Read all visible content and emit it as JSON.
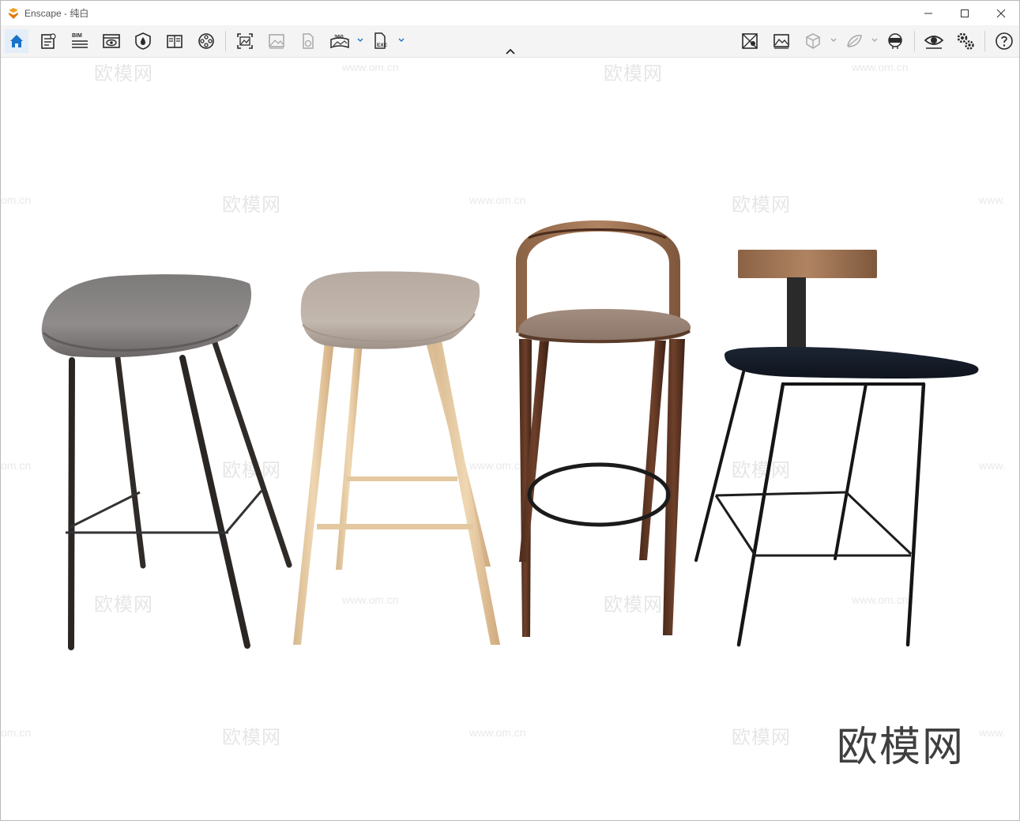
{
  "window": {
    "app_name": "Enscape",
    "separator": " - ",
    "scene_name": "纯白"
  },
  "toolbar": {
    "bim_label": "BIM",
    "pano_label": "360",
    "exe_label": "EXE"
  },
  "watermarks": {
    "cn_text": "欧模网",
    "url_text": "www.om.cn",
    "url_partial_left": "om.cn",
    "url_partial_right": "www.",
    "brand": "欧模网"
  },
  "colors": {
    "accent": "#1a73c8",
    "icon": "#2b2b2b",
    "icon_disabled": "#a8a8a8"
  }
}
